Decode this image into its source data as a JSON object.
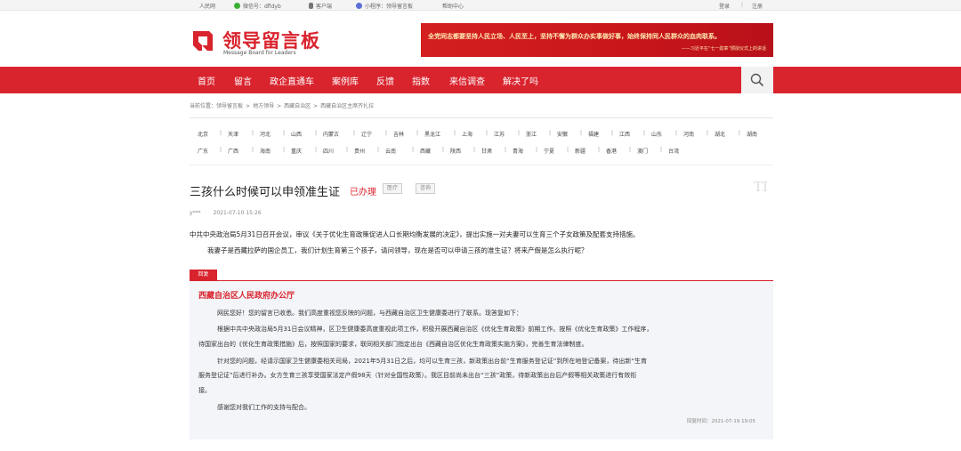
{
  "topbar": {
    "site": "人民网",
    "wechat": "微信号：dfldyb",
    "client": "客户端",
    "miniprogram": "小程序：领导留言板",
    "help": "帮助中心",
    "login": "登录",
    "sep": "|",
    "register": "注册"
  },
  "header": {
    "logo_text": "领导留言板",
    "logo_sub": "Message Board for Leaders",
    "banner_line1": "全党同志都要坚持人民立场、人民至上，坚持不懈为群众办实事做好事，始终保持同人民群众的血肉联系。",
    "banner_line2": "——习近平在“七一勋章”颁授仪式上的讲话"
  },
  "nav": {
    "items": [
      "首页",
      "留言",
      "政企直通车",
      "案例库",
      "反馈",
      "指数",
      "来信调查",
      "解决了吗"
    ],
    "search_icon": "search-icon"
  },
  "breadcrumb": {
    "prefix": "当前位置：",
    "items": [
      "领导留言板",
      "地方领导",
      "西藏自治区",
      "西藏自治区主席齐扎拉"
    ],
    "sep": ">"
  },
  "regions": {
    "row1": [
      "北京",
      "天津",
      "河北",
      "山西",
      "内蒙古",
      "辽宁",
      "吉林",
      "黑龙江",
      "上海",
      "江苏",
      "浙江",
      "安徽",
      "福建",
      "江西",
      "山东",
      "河南",
      "湖北",
      "湖南"
    ],
    "row2": [
      "广东",
      "广西",
      "海南",
      "重庆",
      "四川",
      "贵州",
      "云南",
      "西藏",
      "陕西",
      "甘肃",
      "青海",
      "宁夏",
      "新疆",
      "香港",
      "澳门",
      "台湾"
    ],
    "sep": "|"
  },
  "message": {
    "title": "三孩什么时候可以申领准生证",
    "status": "已办理",
    "tags": [
      "医疗",
      "咨询"
    ],
    "corner_mark": "TI",
    "author": "y***",
    "date": "2021-07-10 15:26",
    "para1": "中共中央政治局5月31日召开会议，审议《关于优化生育政策促进人口长期均衡发展的决定》，提出实施一对夫妻可以生育三个子女政策及配套支持措施。",
    "para2": "我妻子是西藏拉萨的国企员工，我们计划生育第三个孩子，请问领导，现在是否可以申请三孩的准生证？将来产假是怎么执行呢？"
  },
  "reply": {
    "tab_label": "回复",
    "org": "西藏自治区人民政府办公厅",
    "paragraphs": [
      "网民您好！您的留言已收悉。我们高度重视您反映的问题，与西藏自治区卫生健康委进行了联系。现答复如下：",
      "根据中共中央政治局5月31日会议精神，区卫生健康委高度重视此项工作，积极开展西藏自治区《优化生育政策》前期工作。按照《优化生育政策》工作程序，",
      "待国家出台的《优化生育政策措施》后，按照国家的要求，联同相关部门指定出台《西藏自治区优化生育政策实施方案》，完善生育法律制度。",
      "针对您的问题，经请示国家卫生健康委相关司局，2021年5月31日之后，均可以生育三孩，新政策出台前“生育服务登记证”到所在地登记备案，待出新“生育",
      "服务登记证”后进行补办。女方生育三孩享受国家法定产假98天（针对全国性政策）。我区目前尚未出台“三孩”政策，待新政策出台后产假等相关政策进行有效衔",
      "接。",
      "感谢您对我们工作的支持与配合。"
    ],
    "time": "回复时间：2021-07-19 19:05"
  },
  "colors": {
    "brand_red": "#d9232d",
    "reply_bg": "#f3f5f8"
  }
}
